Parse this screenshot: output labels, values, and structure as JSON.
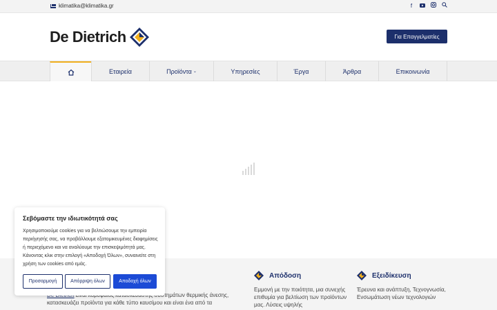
{
  "topbar": {
    "email": "klimatika@klimatika.gr",
    "social": [
      "facebook-icon",
      "youtube-icon",
      "instagram-icon",
      "search-icon"
    ]
  },
  "header": {
    "logo_text": "De Dietrich",
    "pro_button": "Για Επαγγελματίες"
  },
  "nav": {
    "items": [
      {
        "label": "home-icon"
      },
      {
        "label": "Εταιρεία"
      },
      {
        "label": "Προϊόντα"
      },
      {
        "label": "Υπηρεσίες"
      },
      {
        "label": "Έργα"
      },
      {
        "label": "Άρθρα"
      },
      {
        "label": "Επικοινωνία"
      }
    ]
  },
  "cookie": {
    "title": "Σεβόμαστε την ιδιωτικότητά σας",
    "text": "Χρησιμοποιούμε cookies για να βελτιώσουμε την εμπειρία περιήγησής σας, να προβάλλουμε εξατομικευμένες διαφημίσεις ή περιεχόμενο και να αναλύουμε την επισκεψιμότητά μας. Κάνοντας κλικ στην επιλογή «Αποδοχή Όλων», συναινείτε στη χρήση των cookies από εμάς.",
    "customize": "Προσαρμογή",
    "reject": "Απόρριψη όλων",
    "accept": "Αποδοχή όλων"
  },
  "footer": {
    "intro_link": "De Dietrich",
    "intro_text": "είναι κορυφαίος κατασκευαστής συστημάτων θερμικής άνεσης, κατασκευάζει προϊόντα για κάθε τύπο καυσίμου και είναι ένα από τα",
    "features": [
      {
        "title": "Απόδοση",
        "desc": "Εμμονή με την ποιότητα, μια συνεχής επιθυμία για βελτίωση των προϊόντων μας. Λύσεις υψηλής"
      },
      {
        "title": "Εξειδίκευση",
        "desc": "Έρευνα και ανάπτυξη, Τεχνογνωσία, Ενσωμάτωση νέων τεχνολογιών"
      }
    ]
  },
  "colors": {
    "brand": "#1c2f6b",
    "accent": "#f2b01e",
    "accept": "#1c4bd6"
  }
}
